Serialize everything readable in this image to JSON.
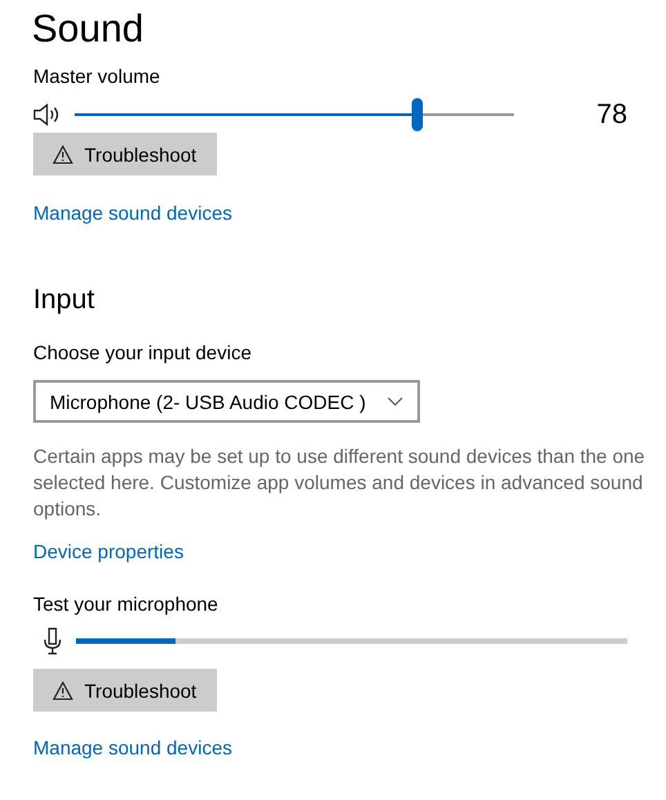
{
  "title": "Sound",
  "output": {
    "volume_label": "Master volume",
    "level": 0.78,
    "reading": "78",
    "troubleshoot": "Troubleshoot",
    "manage_link": "Manage sound devices"
  },
  "input": {
    "heading": "Input",
    "device_label": "Choose your input device",
    "device": "Microphone (2- USB Audio CODEC )",
    "description": "Certain apps may be set up to use different sound devices than the one selected here. Customize app volumes and devices in advanced sound options.",
    "properties_link": "Device properties",
    "test_label": "Test your microphone",
    "level": 0.18,
    "troubleshoot": "Troubleshoot",
    "manage_link": "Manage sound devices"
  }
}
